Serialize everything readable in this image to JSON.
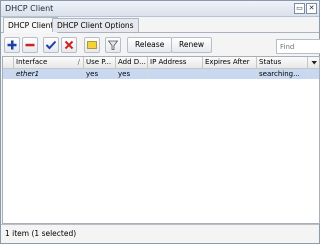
{
  "window": {
    "title": "DHCP Client",
    "restore_glyph": "▭",
    "close_glyph": "✕"
  },
  "tabs": [
    {
      "label": "DHCP Client"
    },
    {
      "label": "DHCP Client Options"
    }
  ],
  "toolbar": {
    "icons": [
      "add-icon",
      "remove-icon",
      "enable-icon",
      "disable-icon",
      "comment-icon",
      "filter-icon"
    ],
    "release_label": "Release",
    "renew_label": "Renew",
    "find_placeholder": "Find"
  },
  "table": {
    "columns": [
      "Interface",
      "Use P...",
      "Add D...",
      "IP Address",
      "Expires After",
      "Status"
    ],
    "sort_indicator": "/",
    "rows": [
      {
        "interface": "ether1",
        "use_peer": "yes",
        "add_default": "yes",
        "ip_address": "",
        "expires_after": "",
        "status": "searching..."
      }
    ]
  },
  "status_bar": {
    "text": "1 item (1 selected)"
  },
  "colors": {
    "selection": "#c7d8f0",
    "title_bar": "#d9e1ec"
  }
}
